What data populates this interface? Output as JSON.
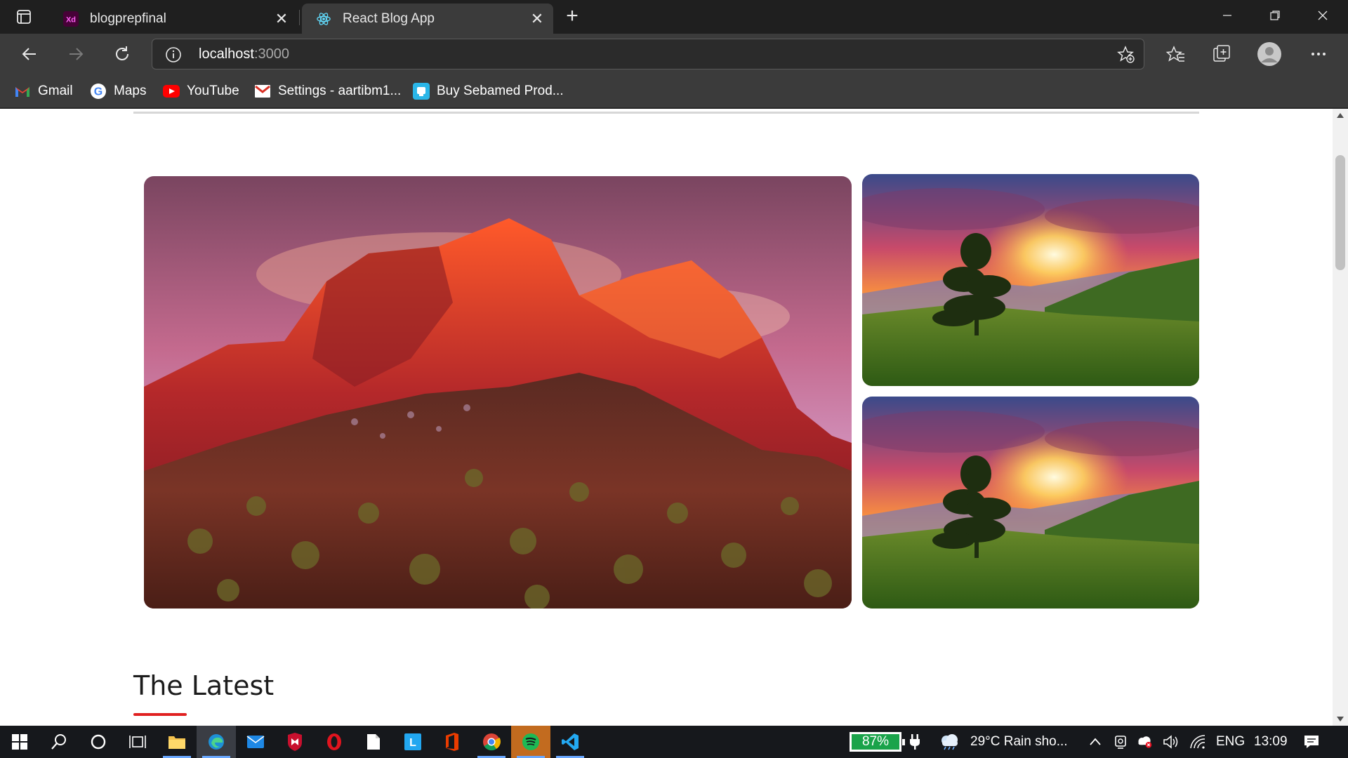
{
  "browser": {
    "tabs": [
      {
        "title": "blogprepfinal",
        "favicon": "xd-icon",
        "active": false
      },
      {
        "title": "React Blog App",
        "favicon": "react-icon",
        "active": true
      }
    ],
    "address": {
      "host": "localhost",
      "port": ":3000"
    },
    "bookmarks": [
      {
        "label": "Gmail",
        "icon": "gmail-icon"
      },
      {
        "label": "Maps",
        "icon": "google-icon"
      },
      {
        "label": "YouTube",
        "icon": "youtube-icon"
      },
      {
        "label": "Settings - aartibm1...",
        "icon": "gmail-icon"
      },
      {
        "label": "Buy Sebamed Prod...",
        "icon": "sebamed-icon"
      }
    ]
  },
  "page": {
    "hero_images": [
      {
        "subject": "red-mountain-landscape"
      },
      {
        "subject": "sunset-tree-landscape"
      },
      {
        "subject": "sunset-tree-landscape"
      }
    ],
    "section_title": "The Latest",
    "accent_color": "#e02020"
  },
  "taskbar": {
    "battery": "87%",
    "weather": "29°C  Rain sho...",
    "language": "ENG",
    "time": "13:09"
  }
}
